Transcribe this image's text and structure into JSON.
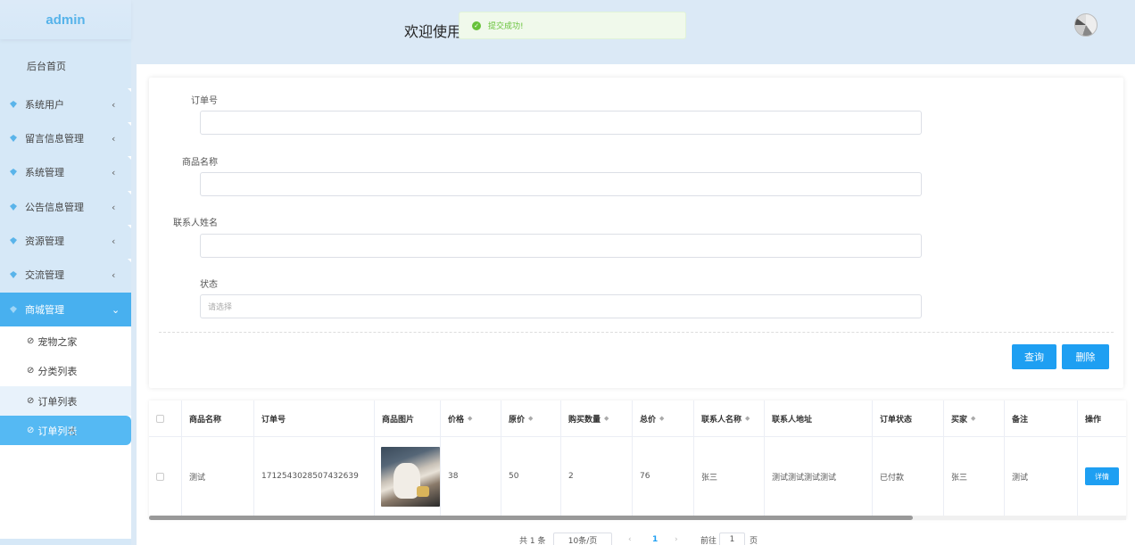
{
  "app": {
    "logo": "admin",
    "welcome": "欢迎使用"
  },
  "toast": {
    "text": "提交成功!",
    "color": "#67c23a"
  },
  "sidebar": {
    "home": "后台首页",
    "items": [
      {
        "label": "系统用户",
        "icon": "diamond-icon"
      },
      {
        "label": "留言信息管理",
        "icon": "diamond-icon"
      },
      {
        "label": "系统管理",
        "icon": "diamond-icon"
      },
      {
        "label": "公告信息管理",
        "icon": "diamond-icon"
      },
      {
        "label": "资源管理",
        "icon": "diamond-icon"
      },
      {
        "label": "交流管理",
        "icon": "diamond-icon"
      },
      {
        "label": "商城管理",
        "icon": "diamond-icon"
      }
    ],
    "sub_items": [
      {
        "label": "宠物之家"
      },
      {
        "label": "分类列表"
      },
      {
        "label": "订单列表"
      },
      {
        "label": "订单列表"
      }
    ],
    "accent": "#48b0ef"
  },
  "form": {
    "order_no_label": "订单号",
    "product_name_label": "商品名称",
    "contact_name_label": "联系人姓名",
    "status_label": "状态",
    "status_placeholder": "请选择",
    "query_button": "查询",
    "delete_button": "删除",
    "button_color": "#1e9ff2"
  },
  "table": {
    "headers": {
      "product_name": "商品名称",
      "order_no": "订单号",
      "product_image": "商品图片",
      "price": "价格",
      "original_price": "原价",
      "quantity": "购买数量",
      "total": "总价",
      "contact_name": "联系人名称",
      "contact_address": "联系人地址",
      "order_status": "订单状态",
      "buyer": "买家",
      "remark": "备注",
      "action": "操作"
    },
    "rows": [
      {
        "product_name": "测试",
        "order_no": "1712543028507432639",
        "price": "38",
        "original_price": "50",
        "quantity": "2",
        "total": "76",
        "contact_name": "张三",
        "contact_address": "测试测试测试测试",
        "order_status": "已付款",
        "buyer": "张三",
        "remark": "测试",
        "action": "详情"
      }
    ]
  },
  "pagination": {
    "total": "共 1 条",
    "page_size": "10条/页",
    "prev": "‹",
    "current": "1",
    "next": "›",
    "goto_prefix": "前往",
    "goto_value": "1",
    "goto_suffix": "页"
  }
}
